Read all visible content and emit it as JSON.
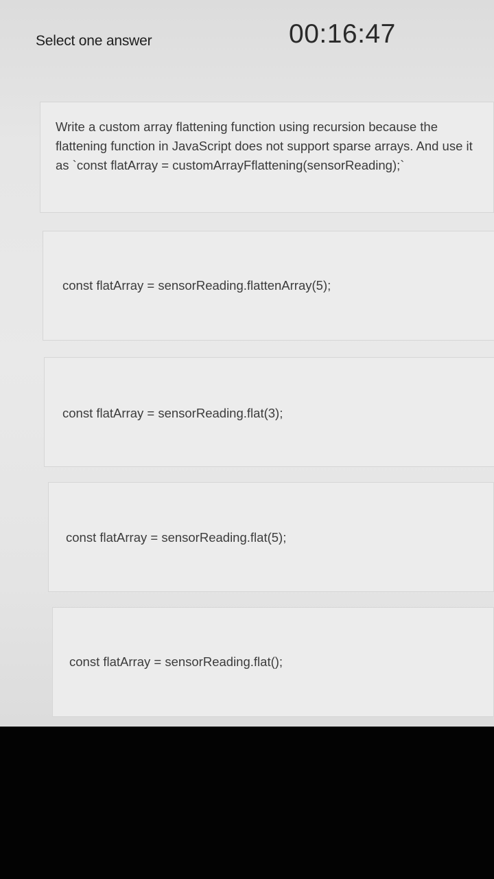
{
  "header": {
    "instruction": "Select one answer",
    "timer": "00:16:47"
  },
  "question": {
    "text": "Write a custom array flattening function using recursion because the flattening function in JavaScript does not support sparse arrays. And use it as `const flatArray = customArrayFflattening(sensorReading);`"
  },
  "options": [
    {
      "label": "const flatArray = sensorReading.flattenArray(5);"
    },
    {
      "label": "const flatArray = sensorReading.flat(3);"
    },
    {
      "label": "const flatArray = sensorReading.flat(5);"
    },
    {
      "label": "const flatArray = sensorReading.flat();"
    }
  ]
}
